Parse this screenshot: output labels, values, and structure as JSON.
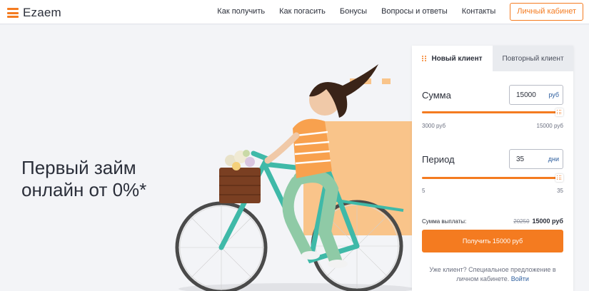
{
  "brand": {
    "name": "Ezaem",
    "color": "#f47b20"
  },
  "nav": {
    "links": [
      "Как получить",
      "Как погасить",
      "Бонусы",
      "Вопросы и ответы",
      "Контакты"
    ],
    "cabinet_label": "Личный кабинет"
  },
  "hero": {
    "title_line1": "Первый займ",
    "title_line2": "онлайн от 0%*"
  },
  "calculator": {
    "tabs": {
      "new_client": "Новый клиент",
      "returning_client": "Повторный клиент",
      "active": "new_client"
    },
    "amount": {
      "label": "Сумма",
      "value": "15000",
      "unit": "руб",
      "min_label": "3000 руб",
      "max_label": "15000 руб",
      "fill_fraction": 1.0
    },
    "period": {
      "label": "Период",
      "value": "35",
      "unit": "дни",
      "min_label": "5",
      "max_label": "35",
      "fill_fraction": 1.0
    },
    "total": {
      "label": "Сумма выплаты:",
      "old_value": "20250",
      "new_value": "15000 руб"
    },
    "submit_label": "Получить 15000 руб",
    "returning_note": "Уже клиент? Специальное предложение в личном кабинете.",
    "login_label": "Войти"
  },
  "illustration": {
    "subject": "woman-riding-bicycle-with-flower-basket"
  }
}
